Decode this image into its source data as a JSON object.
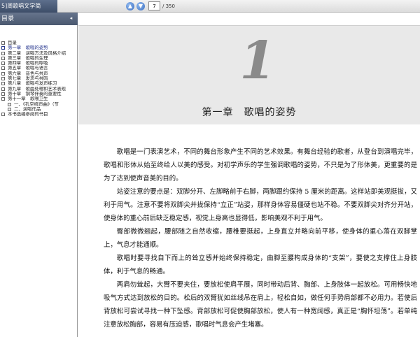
{
  "toolbar": {
    "doc_tab_title": "5]周歌唱文学简",
    "nav_up_icon": "arrow-up-icon",
    "nav_down_icon": "arrow-down-icon",
    "current_page": "7",
    "total_pages": "/ 350"
  },
  "sidebar": {
    "header": "目录",
    "collapse_glyph": "◂",
    "items": [
      {
        "label": "目录",
        "level": 0
      },
      {
        "label": "第一章　歌唱的姿势",
        "level": 0
      },
      {
        "label": "第二章　演唱方法及风格介绍",
        "level": 0
      },
      {
        "label": "第三章　歌唱的生理",
        "level": 0
      },
      {
        "label": "第四章　歌唱的呼吸",
        "level": 0
      },
      {
        "label": "第五章　歌唱与语言",
        "level": 0
      },
      {
        "label": "第六章　音色与共声",
        "level": 0
      },
      {
        "label": "第七章　发声与共鸣",
        "level": 0
      },
      {
        "label": "第八章　歌唱与发声练习",
        "level": 0
      },
      {
        "label": "第九章　歌曲处理和艺术表现",
        "level": 0
      },
      {
        "label": "第十章　钢琴伴奏的重要性",
        "level": 0
      },
      {
        "label": "第十一章　歌喉卫生",
        "level": 0
      },
      {
        "label": "一、《孔空绕声曲》（节",
        "level": 1
      },
      {
        "label": "二、演唱作品",
        "level": 1
      },
      {
        "label": "本书选编参阅的书目",
        "level": 0
      }
    ]
  },
  "chapter": {
    "number": "1",
    "title": "第一章　歌唱的姿势"
  },
  "paragraphs": [
    "歌唱是一门表演艺术，不同的舞台形象产生不同的艺术效果。有舞台经验的歌者，从登台到演唱完毕，歌唱和形体从始至终给人以美的感受。对初学声乐的学生强调歌唱的姿势，不只是为了形体美，更重要的是为了达到使声音美的目的。",
    "站姿注意的要点是：双脚分开、左脚略前于右脚，两脚跟约保持 5 厘米的距离。这样站即美观挺拔，又利于用气。注意不要将双脚尖并拢保持“立正”站姿，那样身体容易僵硬也站不稳。不要双脚尖对齐分开站，使身体的重心前后缺乏稳定感，视觉上身高也显得低，影响美观不利于用气。",
    "臀部微微翘起，腰部随之自然收缩，腰椎要挺起，上身直立并略向前平移，使身体的重心落在双脚掌上，气息才能通顺。",
    "歌唱时要寻找自下而上的耸立感并始终保持稳定，由脚至腰构成身体的“支架”，要使之支撑住上身肢体，利于气息的畅通。",
    "两肩勿耸起，大臂不要夹住，要放松使肩平展，同时带动后背、胸部、上身肢体一起放松。可用畅快地吸气方式达到放松的目的。松后的双臂犹如丝线吊在肩上，轻松自如，做任何手势肩部都不必用力。若使后背放松可尝试寻找一种下坠感。背部放松可促使胸部放松，使人有一种宽阔感，真正是“胸怀坦荡”。若单纯注意放松胸部，容易有压迫感，歌唱时气息会产生堵塞。"
  ]
}
